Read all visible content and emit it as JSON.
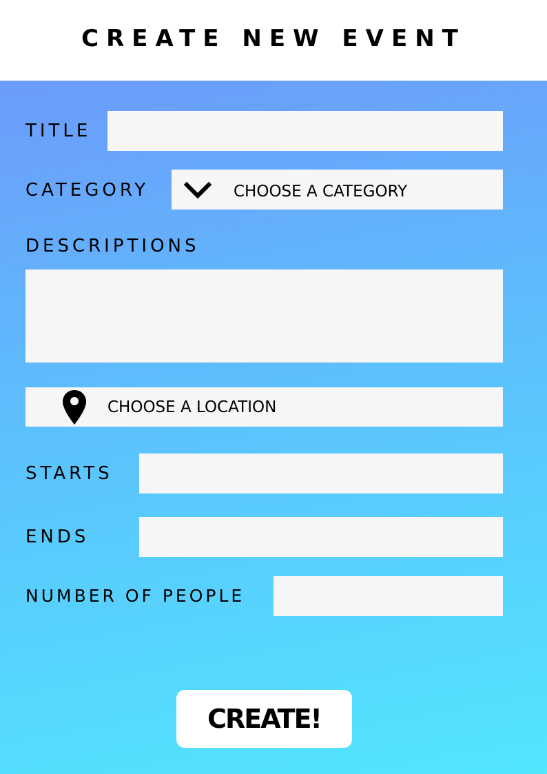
{
  "header": {
    "title": "CREATE NEW EVENT"
  },
  "form": {
    "title_label": "TITLE",
    "title_value": "",
    "category_label": "CATEGORY",
    "category_selected": "CHOOSE A CATEGORY",
    "category_icon": "chevron-down-icon",
    "descriptions_label": "DESCRIPTIONS",
    "descriptions_value": "",
    "location_text": "CHOOSE A LOCATION",
    "location_icon": "map-pin-icon",
    "starts_label": "STARTS",
    "starts_value": "",
    "ends_label": "ENDS",
    "ends_value": "",
    "people_label": "NUMBER OF PEOPLE",
    "people_value": ""
  },
  "actions": {
    "create_label": "CREATE!"
  },
  "colors": {
    "gradient_top": "#6c9bfb",
    "gradient_bottom": "#52e6ff",
    "field_background": "#f6f6f6"
  }
}
